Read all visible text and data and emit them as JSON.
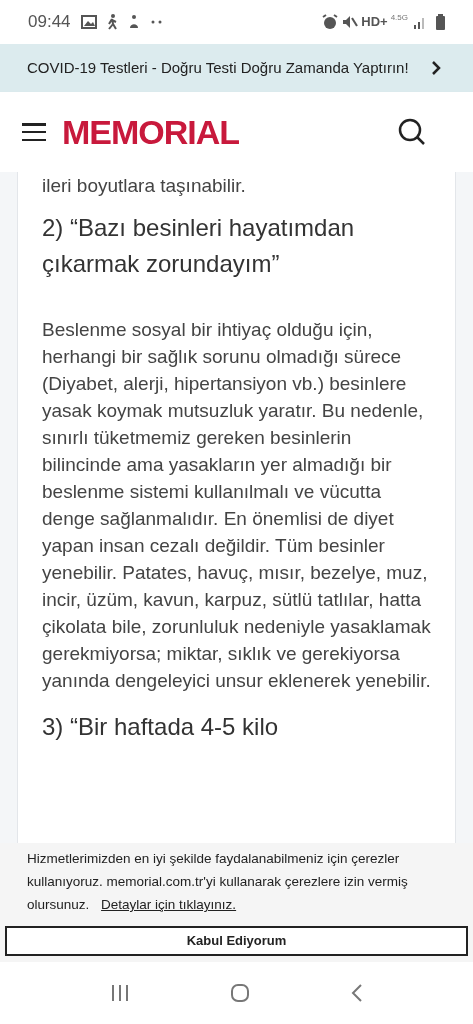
{
  "status_bar": {
    "time": "09:44",
    "network": "HD+",
    "network_type": "4.5G"
  },
  "promo_banner": {
    "text": "COVID-19 Testleri - Doğru Testi Doğru Zamanda Yaptırın!"
  },
  "header": {
    "logo": "MEMORIAL"
  },
  "article": {
    "previous_line": "ileri boyutlara taşınabilir.",
    "heading": "2) “Bazı besinleri hayatımdan çıkarmak zorundayım”",
    "paragraph": "Beslenme sosyal bir ihtiyaç olduğu için, herhangi bir sağlık sorunu olmadığı sürece (Diyabet, alerji, hipertansiyon vb.) besinlere yasak koymak mutsuzluk yaratır. Bu nedenle, sınırlı tüketmemiz gereken besinlerin bilincinde ama yasakların yer almadığı bir beslenme sistemi kullanılmalı ve vücutta denge sağlanmalıdır. En önemlisi de diyet yapan insan cezalı değildir. Tüm besinler yenebilir. Patates, havuç, mısır, bezelye, muz, incir, üzüm, kavun, karpuz, sütlü tatlılar, hatta çikolata bile, zorunluluk nedeniyle yasaklamak gerekmiyorsa; miktar, sıklık ve gerekiyorsa yanında dengeleyici unsur eklenerek yenebilir.",
    "next_heading": "3) “Bir haftada 4-5 kilo"
  },
  "cookie_notice": {
    "text": "Hizmetlerimizden en iyi şekilde faydalanabilmeniz için çerezler kullanıyoruz. memorial.com.tr'yi kullanarak çerezlere izin vermiş olursunuz.",
    "link": "Detaylar için tıklayınız.",
    "button": "Kabul Ediyorum"
  }
}
